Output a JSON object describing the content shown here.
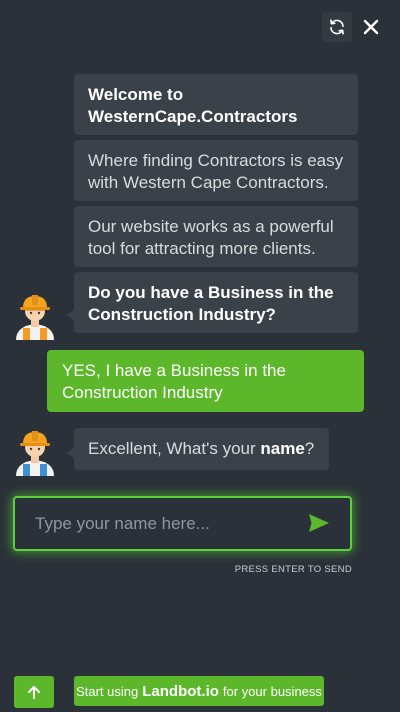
{
  "header": {
    "refresh_icon": "refresh-icon",
    "close_icon": "close-icon"
  },
  "messages": [
    {
      "from": "bot",
      "text": "Welcome to WesternCape.Contractors",
      "bold": true
    },
    {
      "from": "bot",
      "text": "Where finding Contractors is easy with Western Cape Contractors."
    },
    {
      "from": "bot",
      "text": "Our website works as a powerful tool for attracting more clients."
    },
    {
      "from": "bot",
      "text": "Do you have a Business in the Construction Industry?",
      "bold": true
    },
    {
      "from": "user",
      "text": "YES, I have a Business in the Construction Industry"
    },
    {
      "from": "bot",
      "text_before": "Excellent,  What's your ",
      "text_bold": "name",
      "text_after": "?"
    }
  ],
  "input": {
    "placeholder": "Type your name here...",
    "value": "",
    "hint": "PRESS ENTER TO SEND"
  },
  "footer": {
    "promo_prefix": "Start using",
    "promo_brand": "Landbot.io",
    "promo_suffix": "for your business"
  },
  "colors": {
    "background": "#2b3138",
    "bot_bubble": "#3a4148",
    "accent_green": "#5cb82a",
    "input_glow": "#5bd13a"
  }
}
